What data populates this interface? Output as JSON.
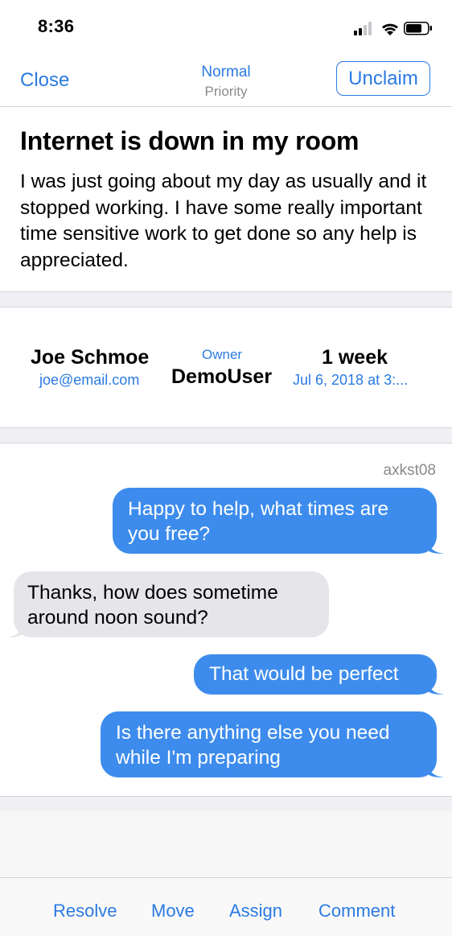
{
  "status_bar": {
    "time": "8:36",
    "icons": [
      "signal-icon",
      "wifi-icon",
      "battery-icon"
    ]
  },
  "nav": {
    "close_label": "Close",
    "priority_value": "Normal",
    "priority_label": "Priority",
    "unclaim_label": "Unclaim"
  },
  "ticket": {
    "title": "Internet is down in my room",
    "description": "I was just going about my day as usually and it stopped working. I have some really important time sensitive work to get done so any help is appreciated."
  },
  "info": {
    "requester_name": "Joe Schmoe",
    "requester_email": "joe@email.com",
    "owner_label": "Owner",
    "owner_name": "DemoUser",
    "age": "1 week",
    "date": "Jul 6, 2018 at 3:..."
  },
  "conversation": {
    "user_label": "axkst08",
    "messages": [
      {
        "direction": "outgoing",
        "text": "Happy to help, what times are you free?"
      },
      {
        "direction": "incoming",
        "text": "Thanks, how does sometime around noon sound?"
      },
      {
        "direction": "outgoing",
        "text": "That would be perfect"
      },
      {
        "direction": "outgoing",
        "text": "Is there anything else you need while I'm preparing"
      }
    ]
  },
  "toolbar": {
    "resolve_label": "Resolve",
    "move_label": "Move",
    "assign_label": "Assign",
    "comment_label": "Comment"
  },
  "colors": {
    "accent": "#2a7ae2",
    "outgoing_bubble": "#3d8ced",
    "incoming_bubble": "#e5e5ea"
  }
}
